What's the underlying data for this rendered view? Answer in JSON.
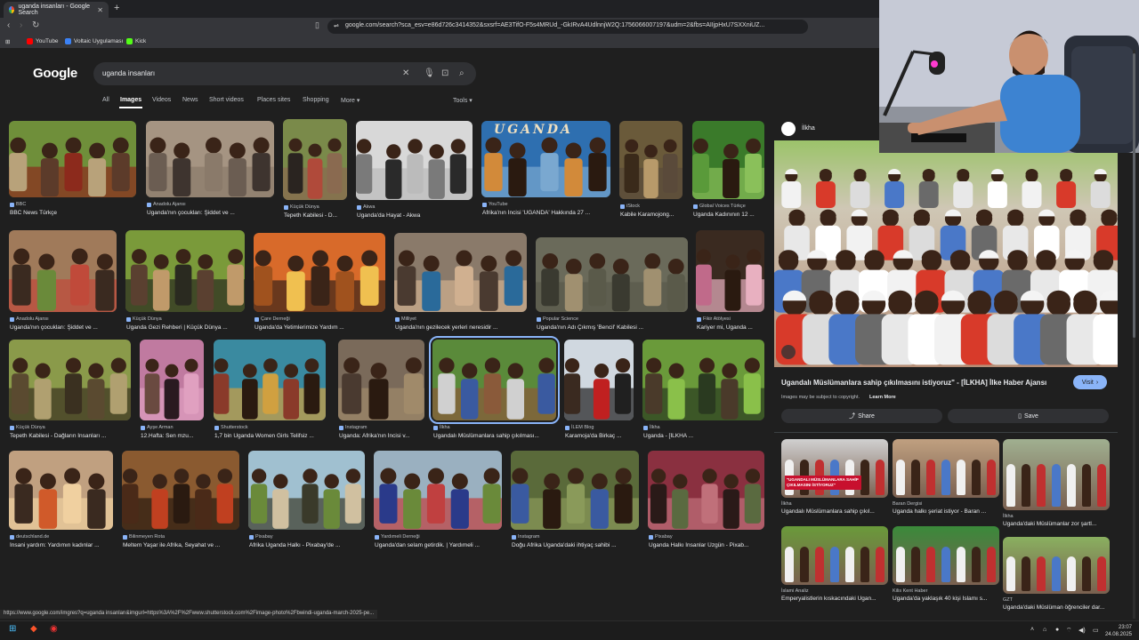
{
  "browser": {
    "tab_title": "uganda insanları - Google Search",
    "new_tab": "+",
    "address": "google.com/search?sca_esv=e86d726c3414352&sxsrf=AE3TifO-F5s4MRUd_-GkIRvA4UdlnnjW2Q:1756066007197&udm=2&fbs=AIIjpHxU7SXXniUZ...",
    "bookmarks": [
      {
        "label": "YouTube",
        "color": "#ff0000"
      },
      {
        "label": "Voltaic Uygulaması",
        "color": "#3b82f6"
      },
      {
        "label": "Kick",
        "color": "#53fc18"
      }
    ]
  },
  "google": {
    "logo": "Google",
    "query": "uganda insanları",
    "tabs": [
      "All",
      "Images",
      "Videos",
      "News",
      "Short videos",
      "Places sites",
      "Shopping",
      "More"
    ],
    "active_tab": "Images",
    "tools": "Tools"
  },
  "results": [
    {
      "source": "BBC",
      "caption": "BBC News Türkçe"
    },
    {
      "source": "Anadolu Ajansı",
      "caption": "Uganda'nın çocukları: Şiddet ve ..."
    },
    {
      "source": "Küçük Dünya",
      "caption": "Tepeth Kabilesi - D..."
    },
    {
      "source": "Akwa",
      "caption": "Uganda'da Hayat - Akwa"
    },
    {
      "source": "YouTube",
      "caption": "Afrika'nın İncisi 'UGANDA' Hakkında 27 ...",
      "overlay": "UGANDA"
    },
    {
      "source": "iStock",
      "caption": "Kabile Karamojong..."
    },
    {
      "source": "Global Voices Türkçe",
      "caption": "Uganda Kadınının 12 ..."
    },
    {
      "source": "Anadolu Ajansı",
      "caption": "Uganda'nın çocukları: Şiddet ve ..."
    },
    {
      "source": "Küçük Dünya",
      "caption": "Uganda Gezi Rehberi | Küçük Dünya ..."
    },
    {
      "source": "Çare Derneği",
      "caption": "Uganda'da Yetimlerimize Yardım ..."
    },
    {
      "source": "Milliyet",
      "caption": "Uganda'nın gezilecek yerleri neresidir ..."
    },
    {
      "source": "Popular Science",
      "caption": "Uganda'nın Adı Çıkmış 'Bencil' Kabilesi ..."
    },
    {
      "source": "Fikir Atölyesi",
      "caption": "Kariyer mi, Uganda ..."
    },
    {
      "source": "Küçük Dünya",
      "caption": "Tepeth Kabilesi - Dağların İnsanları ..."
    },
    {
      "source": "Ayşe Arman",
      "caption": "12.Hafta: Sen mzu..."
    },
    {
      "source": "Shutterstock",
      "caption": "1,7 bin Uganda Women Girls Telifsiz ..."
    },
    {
      "source": "Instagram",
      "caption": "Uganda: Afrika'nın İncisi v..."
    },
    {
      "source": "İlkha",
      "caption": "Ugandalı Müslümanlara sahip çıkılması..."
    },
    {
      "source": "İLEM Blog",
      "caption": "Karamoja'da Birkaç ..."
    },
    {
      "source": "İlkha",
      "caption": "Uganda - [İLKHA ..."
    },
    {
      "source": "deutschland.de",
      "caption": "İnsani yardım: Yardımın kadınlar ..."
    },
    {
      "source": "Bilinmeyen Rota",
      "caption": "Meltem Yaşar ile Afrika, Seyahat ve ..."
    },
    {
      "source": "Pixabay",
      "caption": "Afrika Uganda Halkı - Pixabay'de ..."
    },
    {
      "source": "Yardımeli Derneği",
      "caption": "Uganda'dan selam getirdik. | Yardımeli ..."
    },
    {
      "source": "Instagram",
      "caption": "Doğu Afrika Uganda'daki ihtiyaç sahibi ..."
    },
    {
      "source": "Pixabay",
      "caption": "Uganda Halkı İnsanlar Üzgün - Pixab..."
    }
  ],
  "panel": {
    "site": "İlkha",
    "title": "Ugandalı Müslümanlara sahip çıkılmasını istiyoruz\" - [İLKHA] İlke Haber Ajansı",
    "visit": "Visit",
    "copyright": "Images may be subject to copyright.",
    "learn_more": "Learn More",
    "share": "Share",
    "save": "Save",
    "banner": "\"UGANDALI MÜSLÜMANLARA SAHİP ÇIKILMASINI İSTİYORUZ\"",
    "related": [
      {
        "source": "İlkha",
        "caption": "Ugandalı Müslümanlara sahip çıkıl..."
      },
      {
        "source": "Baran Dergisi",
        "caption": "Uganda halkı şeriat istiyor - Baran ..."
      },
      {
        "source": "İlkha",
        "caption": "Uganda'daki Müslümanlar zor şartl..."
      },
      {
        "source": "İslami Analiz",
        "caption": "Emperyalistlerin kıskacındaki Ugan..."
      },
      {
        "source": "Kilis Kent Haber",
        "caption": "Uganda'da yaklaşık 40 kişi İslamı s..."
      },
      {
        "source": "GZT",
        "caption": "Uganda'daki Müslüman öğrenciler dar..."
      }
    ]
  },
  "status_url": "https://www.google.com/imgres?q=uganda insanları&imgurl=https%3A%2F%2Fwww.shutterstock.com%2Fimage-photo%2Fbwindi-uganda-march-2025-pe...",
  "taskbar": {
    "time": "23:07",
    "date": "24.08.2025"
  }
}
